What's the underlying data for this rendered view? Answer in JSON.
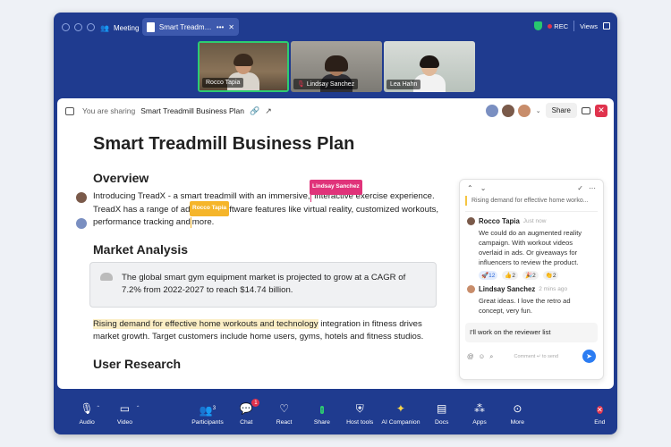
{
  "titlebar": {
    "meeting_tab": "Meeting",
    "doc_tab": "Smart Treadmill...",
    "rec_label": "REC",
    "views_label": "Views"
  },
  "participants": [
    {
      "name": "Rocco Tapia"
    },
    {
      "name": "Lindsay Sanchez"
    },
    {
      "name": "Lea Hahn"
    }
  ],
  "share_bar": {
    "label": "You are sharing",
    "doc_title": "Smart Treadmill Business Plan",
    "share_button": "Share"
  },
  "document": {
    "title": "Smart Treadmill Business Plan",
    "overview_heading": "Overview",
    "overview_p1a": "Introducing TreadX - a smart treadmill with an immersive,",
    "overview_p1b": "interactive exercise experience.",
    "overview_p2a": "TreadX has a range of adv",
    "overview_p2b": "nced software features like virtual reality, customized workouts,",
    "overview_p3a": "performance tracking and",
    "overview_p3b": "more.",
    "cursor_lindsay": "Lindsay Sanchez",
    "cursor_rocco": "Rocco Tapia",
    "market_heading": "Market Analysis",
    "callout_text": "The global smart gym equipment market is projected to grow at a CAGR of 7.2% from 2022-2027 to reach $14.74 billion.",
    "market_p_highlight": "Rising demand for effective home workouts and technology",
    "market_p_rest": " integration in fitness drives market growth. Target customers include home users, gyms, hotels and fitness studios.",
    "research_heading": "User Research"
  },
  "comments": {
    "quote": "Rising demand for effective home worko...",
    "items": [
      {
        "name": "Rocco Tapia",
        "time": "Just now",
        "body": "We could do an augmented reality campaign. With workout videos overlaid in ads. Or giveaways for influencers to review the product.",
        "reactions": [
          "🚀12",
          "👍2",
          "🎉2",
          "👏2"
        ]
      },
      {
        "name": "Lindsay Sanchez",
        "time": "2 mins ago",
        "body": "Great ideas. I love the retro ad concept, very fun."
      }
    ],
    "input_value": "I'll work on the reviewer list",
    "hint": "Comment ↵ to send"
  },
  "toolbar": {
    "audio": "Audio",
    "video": "Video",
    "participants": "Participants",
    "participants_count": "3",
    "chat": "Chat",
    "chat_badge": "1",
    "react": "React",
    "share": "Share",
    "host_tools": "Host tools",
    "ai_companion": "AI Companion",
    "docs": "Docs",
    "apps": "Apps",
    "more": "More",
    "end": "End"
  },
  "colors": {
    "frame": "#1f3b8f",
    "rec": "#e0334d",
    "lindsay_cursor": "#e0337a",
    "rocco_cursor": "#f5b52a",
    "send": "#2b7cf2"
  }
}
